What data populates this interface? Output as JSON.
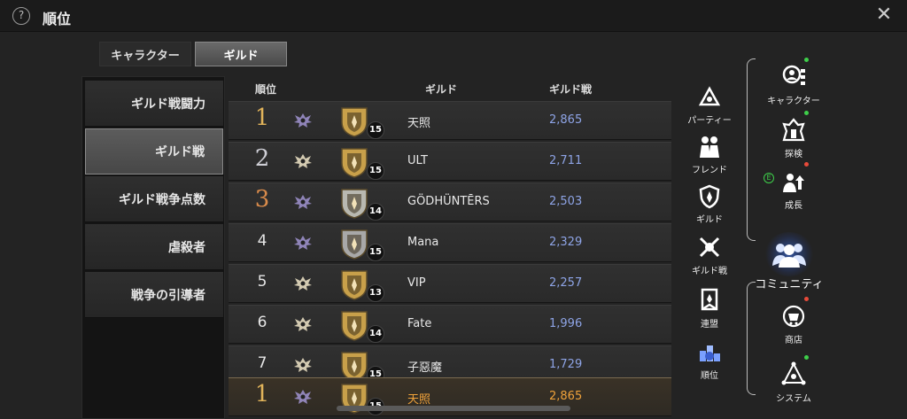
{
  "header": {
    "help_icon_glyph": "?",
    "title": "順位",
    "close_glyph": "✕"
  },
  "tabs": [
    {
      "label": "キャラクター",
      "active": false
    },
    {
      "label": "ギルド",
      "active": true
    }
  ],
  "categories": [
    {
      "label": "ギルド戦闘力",
      "active": false
    },
    {
      "label": "ギルド戦",
      "active": true
    },
    {
      "label": "ギルド戦争点数",
      "active": false
    },
    {
      "label": "虐殺者",
      "active": false
    },
    {
      "label": "戦争の引導者",
      "active": false
    }
  ],
  "table": {
    "headers": {
      "rank": "順位",
      "guild": "ギルド",
      "power": "ギルド戦"
    },
    "rows": [
      {
        "rank": "1",
        "rank_style": "gold",
        "level": "15",
        "name": "天照",
        "power": "2,865",
        "wing_color": "#9a8ec8",
        "emblem_color": "#c8a04a"
      },
      {
        "rank": "2",
        "rank_style": "silver",
        "level": "15",
        "name": "ULT",
        "power": "2,711",
        "wing_color": "#e6dcc0",
        "emblem_color": "#c8a04a"
      },
      {
        "rank": "3",
        "rank_style": "bronze",
        "level": "14",
        "name": "GÖDHÜNTĒRS",
        "power": "2,503",
        "wing_color": "#9a8ec8",
        "emblem_color": "#b8b8b0"
      },
      {
        "rank": "4",
        "rank_style": "plain",
        "level": "15",
        "name": "Mana",
        "power": "2,329",
        "wing_color": "#9a8ec8",
        "emblem_color": "#a8a8a8"
      },
      {
        "rank": "5",
        "rank_style": "plain",
        "level": "13",
        "name": "VIP",
        "power": "2,257",
        "wing_color": "#e6dcc0",
        "emblem_color": "#c8a04a"
      },
      {
        "rank": "6",
        "rank_style": "plain",
        "level": "14",
        "name": "Fate",
        "power": "1,996",
        "wing_color": "#e6dcc0",
        "emblem_color": "#c8a04a"
      },
      {
        "rank": "7",
        "rank_style": "plain",
        "level": "15",
        "name": "子惡魔",
        "power": "1,729",
        "wing_color": "#e6dcc0",
        "emblem_color": "#c8a04a"
      }
    ],
    "my_guild": {
      "rank": "1",
      "rank_style": "gold",
      "level": "15",
      "name": "天照",
      "power": "2,865",
      "wing_color": "#9a8ec8",
      "emblem_color": "#c8a04a"
    }
  },
  "menu_left": [
    {
      "label": "パーティー",
      "icon": "party-icon"
    },
    {
      "label": "フレンド",
      "icon": "friends-icon"
    },
    {
      "label": "ギルド",
      "icon": "guild-icon"
    },
    {
      "label": "ギルド戦",
      "icon": "guild-war-icon"
    },
    {
      "label": "連盟",
      "icon": "alliance-icon"
    },
    {
      "label": "順位",
      "icon": "ranking-icon",
      "active": true
    }
  ],
  "menu_right": [
    {
      "label": "キャラクター",
      "icon": "character-icon",
      "dot": "green"
    },
    {
      "label": "探検",
      "icon": "explore-icon",
      "dot": "green"
    },
    {
      "label": "成長",
      "icon": "growth-icon",
      "dot": "red",
      "badge": "E"
    },
    {
      "label": "商店",
      "icon": "shop-icon",
      "dot": "red"
    },
    {
      "label": "システム",
      "icon": "system-icon",
      "dot": "green"
    }
  ],
  "community": {
    "label": "コミュニティ",
    "icon": "community-icon"
  },
  "colors": {
    "accent_blue": "#8ea4e6",
    "my_guild_orange": "#f0a23a",
    "gold": "#e0b35a"
  }
}
